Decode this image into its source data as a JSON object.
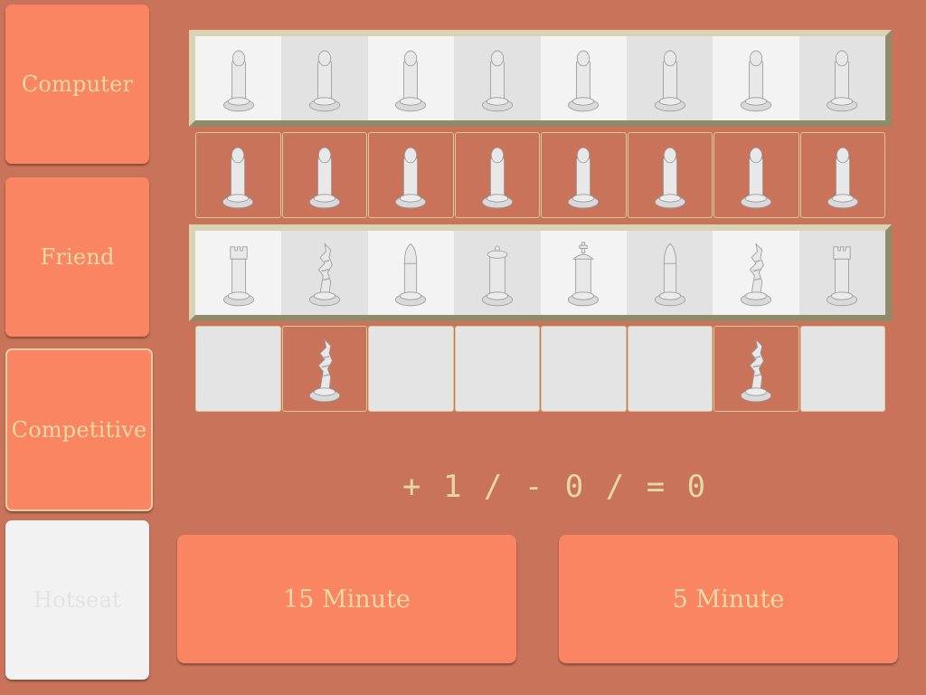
{
  "modes": [
    {
      "label": "Computer",
      "state": "normal"
    },
    {
      "label": "Friend",
      "state": "normal"
    },
    {
      "label": "Competitive",
      "state": "selected"
    },
    {
      "label": "Hotseat",
      "state": "disabled"
    }
  ],
  "board": {
    "back_pawns": [
      "pawn",
      "pawn",
      "pawn",
      "pawn",
      "pawn",
      "pawn",
      "pawn",
      "pawn"
    ],
    "pawn_cells": [
      "pawn",
      "pawn",
      "pawn",
      "pawn",
      "pawn",
      "pawn",
      "pawn",
      "pawn"
    ],
    "back_rank": [
      "rook",
      "knight",
      "bishop",
      "queen",
      "king",
      "bishop",
      "knight",
      "rook"
    ],
    "bottom_cells": [
      "",
      "knight",
      "",
      "",
      "",
      "",
      "knight",
      ""
    ]
  },
  "score": {
    "text": "+ 1 / - 0 / = 0"
  },
  "time_controls": {
    "left_label": "15 Minute",
    "right_label": "5 Minute"
  },
  "colors": {
    "background": "#c8735a",
    "button": "#fa8563",
    "text": "#eed9a2"
  }
}
